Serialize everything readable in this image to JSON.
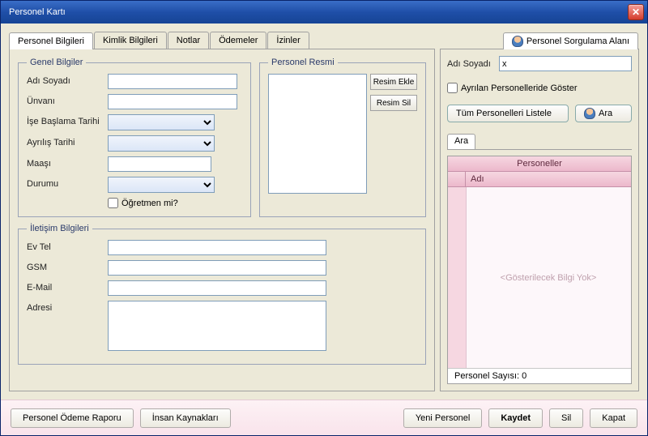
{
  "title": "Personel Kartı",
  "tabs": {
    "personel": "Personel Bilgileri",
    "kimlik": "Kimlik Bilgileri",
    "notlar": "Notlar",
    "odemeler": "Ödemeler",
    "izinler": "İzinler"
  },
  "rightTab": "Personel Sorgulama Alanı",
  "genel": {
    "legend": "Genel Bilgiler",
    "adiSoyadi_label": "Adı Soyadı",
    "unvani_label": "Ünvanı",
    "iseBaslama_label": "İşe Başlama Tarihi",
    "ayrilis_label": "Ayrılış Tarihi",
    "maasi_label": "Maaşı",
    "durumu_label": "Durumu",
    "ogretmen_label": "Öğretmen mi?",
    "adiSoyadi": "",
    "unvani": "",
    "iseBaslama": "",
    "ayrilis": "",
    "maasi": "",
    "durumu": "",
    "ogretmen": false
  },
  "resim": {
    "legend": "Personel Resmi",
    "ekle": "Resim Ekle",
    "sil": "Resim Sil"
  },
  "iletisim": {
    "legend": "İletişim Bilgileri",
    "evtel_label": "Ev Tel",
    "gsm_label": "GSM",
    "email_label": "E-Mail",
    "adresi_label": "Adresi",
    "evtel": "",
    "gsm": "",
    "email": "",
    "adresi": ""
  },
  "search": {
    "adiSoyadi_label": "Adı Soyadı",
    "adiSoyadi": "x",
    "ayrilan_label": "Ayrılan Personelleride Göster",
    "tumListele": "Tüm Personelleri Listele",
    "ara": "Ara",
    "araTab": "Ara"
  },
  "grid": {
    "title": "Personeller",
    "col_adi": "Adı",
    "empty": "<Gösterilecek Bilgi Yok>",
    "footer": "Personel Sayısı: 0"
  },
  "bottom": {
    "odemeRaporu": "Personel Ödeme Raporu",
    "insanKaynaklari": "İnsan Kaynakları",
    "yeni": "Yeni Personel",
    "kaydet": "Kaydet",
    "sil": "Sil",
    "kapat": "Kapat"
  }
}
